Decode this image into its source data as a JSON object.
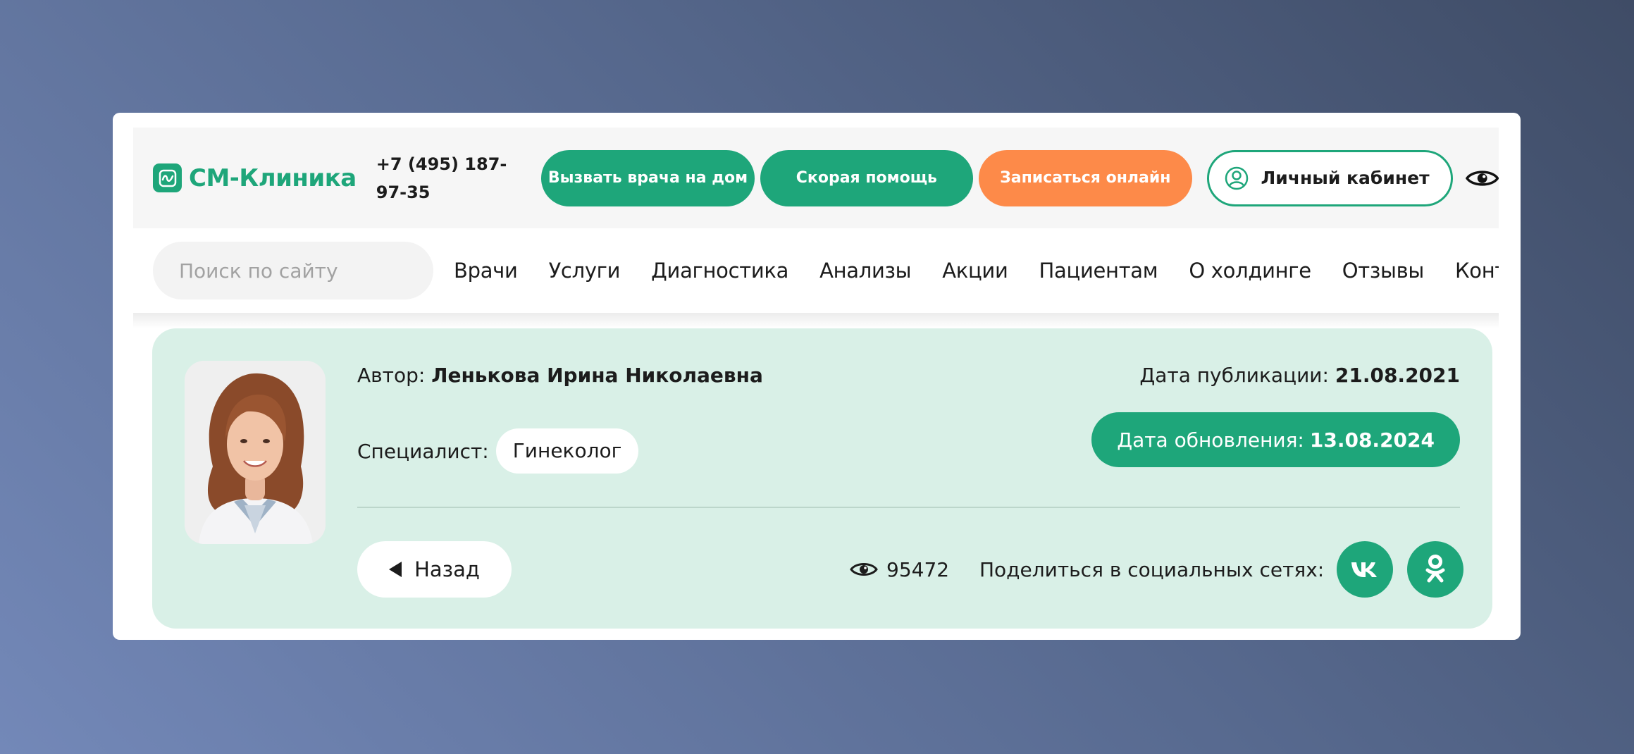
{
  "header": {
    "logo_text": "СМ-Клиника",
    "phone": "+7 (495) 187-97-35",
    "buttons": {
      "call_doctor": "Вызвать врача на дом",
      "ambulance": "Скорая помощь",
      "book_online": "Записаться онлайн",
      "cabinet": "Личный кабинет"
    },
    "colors": {
      "brand": "#1ea67a",
      "accent": "#fd8a49"
    }
  },
  "search": {
    "placeholder": "Поиск по сайту"
  },
  "nav": {
    "items": [
      "Врачи",
      "Услуги",
      "Диагностика",
      "Анализы",
      "Акции",
      "Пациентам",
      "О холдинге",
      "Отзывы",
      "Контакты"
    ]
  },
  "author": {
    "author_label": "Автор:",
    "author_name": "Ленькова Ирина Николаевна",
    "specialist_label": "Специалист:",
    "specialty": "Гинеколог",
    "published_label": "Дата публикации:",
    "published_date": "21.08.2021",
    "updated_label": "Дата обновления:",
    "updated_date": "13.08.2024"
  },
  "footer": {
    "back_label": "Назад",
    "views_count": "95472",
    "share_label": "Поделиться в социальных сетях:",
    "social": [
      "vk-icon",
      "odnoklassniki-icon"
    ]
  }
}
